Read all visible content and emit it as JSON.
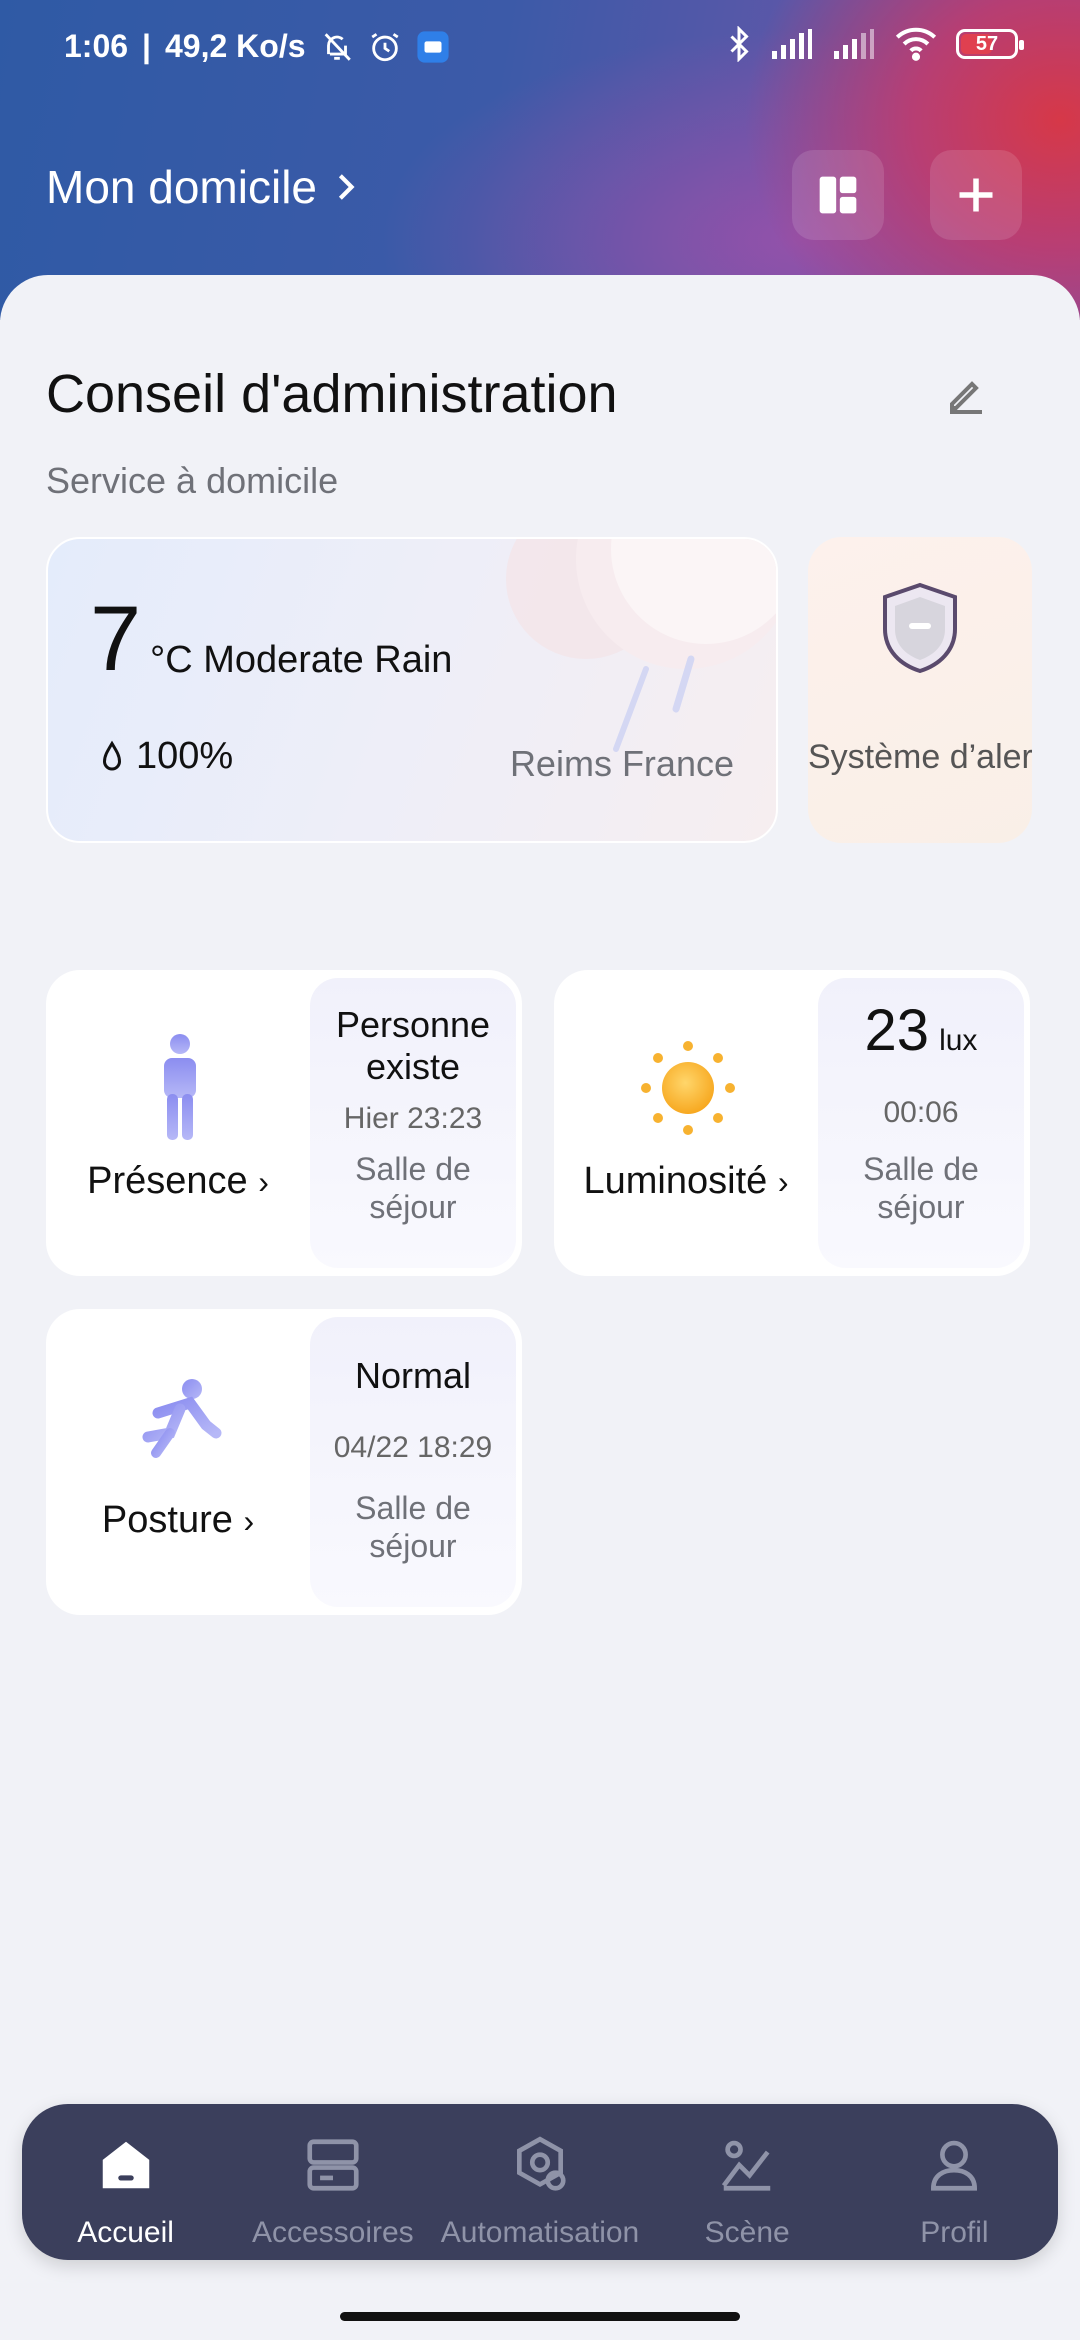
{
  "status_bar": {
    "time": "1:06",
    "speed": "49,2 Ko/s",
    "battery": "57"
  },
  "header": {
    "home_name": "Mon domicile"
  },
  "board": {
    "title": "Conseil d'administration",
    "subtitle": "Service à domicile"
  },
  "weather": {
    "temperature": "7",
    "description": "°C Moderate Rain",
    "humidity": "100%",
    "location": "Reims France"
  },
  "alert": {
    "label": "Système d’alerte désa…"
  },
  "sensors": [
    {
      "name": "Présence",
      "value": "Personne existe",
      "time": "Hier 23:23",
      "room": "Salle de séjour",
      "icon": "person-icon"
    },
    {
      "name": "Luminosité",
      "value": "23",
      "unit": "lux",
      "time": "00:06",
      "room": "Salle de séjour",
      "icon": "sun-icon"
    },
    {
      "name": "Posture",
      "value": "Normal",
      "time": "04/22 18:29",
      "room": "Salle de séjour",
      "icon": "fall-posture-icon"
    }
  ],
  "nav": {
    "items": [
      {
        "label": "Accueil",
        "icon": "home-icon",
        "active": true
      },
      {
        "label": "Accessoires",
        "icon": "accessories-icon",
        "active": false
      },
      {
        "label": "Automatisation",
        "icon": "automation-icon",
        "active": false
      },
      {
        "label": "Scène",
        "icon": "scene-icon",
        "active": false
      },
      {
        "label": "Profil",
        "icon": "profile-icon",
        "active": false
      }
    ]
  },
  "colors": {
    "nav_bg": "#3b3f5c",
    "nav_inactive": "#8f93a8",
    "header_red": "#d63848",
    "header_blue": "#2f5aa5"
  }
}
